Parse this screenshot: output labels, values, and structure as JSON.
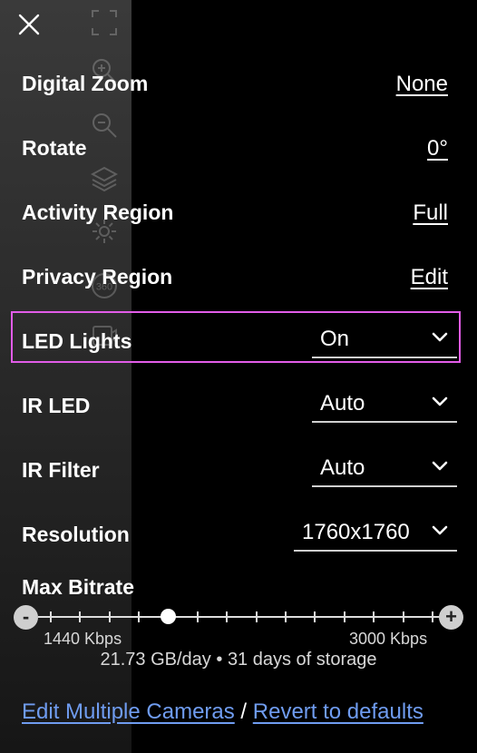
{
  "icons": {
    "close": "close-icon",
    "sidebar": [
      "fullscreen-icon",
      "zoom-in-icon",
      "zoom-out-icon",
      "layers-icon",
      "gear-icon",
      "360-icon",
      "overlay-icon"
    ]
  },
  "sidebar": {
    "badge_360": "360"
  },
  "settings": {
    "digital_zoom": {
      "label": "Digital Zoom",
      "value": "None"
    },
    "rotate": {
      "label": "Rotate",
      "value": "0°"
    },
    "activity_region": {
      "label": "Activity Region",
      "value": "Full"
    },
    "privacy_region": {
      "label": "Privacy Region",
      "value": "Edit"
    },
    "led_lights": {
      "label": "LED Lights",
      "value": "On"
    },
    "ir_led": {
      "label": "IR LED",
      "value": "Auto"
    },
    "ir_filter": {
      "label": "IR Filter",
      "value": "Auto"
    },
    "resolution": {
      "label": "Resolution",
      "value": "1760x1760"
    }
  },
  "bitrate": {
    "label": "Max Bitrate",
    "minus": "-",
    "plus": "+",
    "min_label": "1440 Kbps",
    "max_label": "3000 Kbps",
    "storage_per_day": "21.73 GB/day",
    "storage_sep": " • ",
    "storage_days": "31 days of storage",
    "ticks": 14,
    "selected_index": 4
  },
  "footer": {
    "edit_multiple": "Edit Multiple Cameras",
    "separator": " / ",
    "revert": "Revert to defaults"
  },
  "colors": {
    "highlight": "#e25ce8",
    "link": "#6f9cf0"
  }
}
